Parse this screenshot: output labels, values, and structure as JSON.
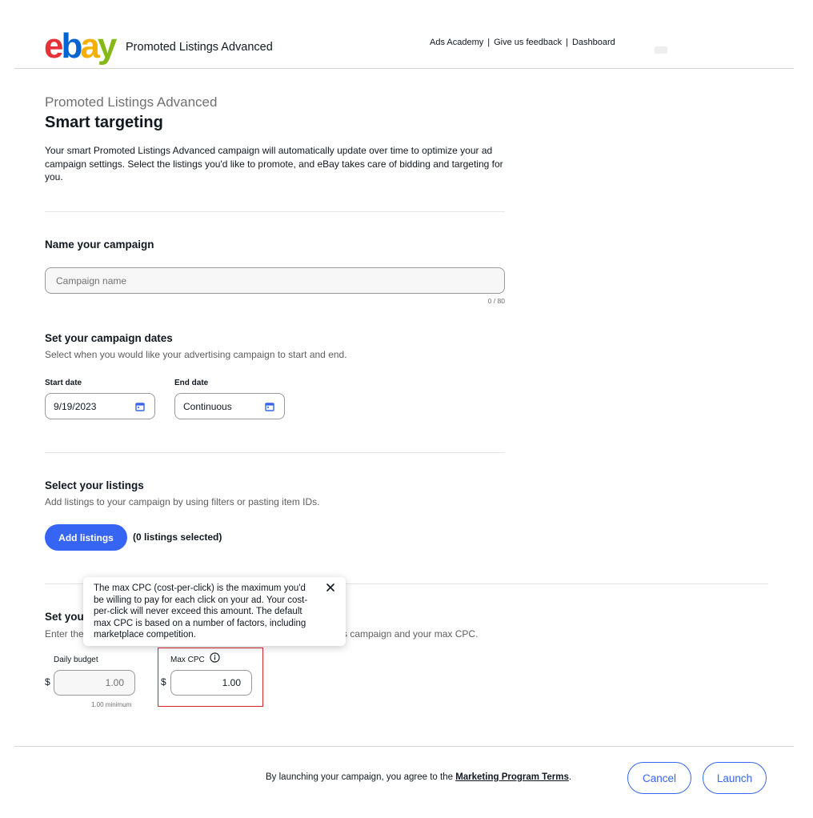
{
  "header": {
    "logo_letters": [
      "e",
      "b",
      "a",
      "y"
    ],
    "product_name": "Promoted Listings Advanced",
    "links": [
      "Ads Academy",
      "Give us feedback",
      "Dashboard"
    ],
    "separator": "|"
  },
  "page": {
    "eyebrow": "Promoted Listings Advanced",
    "title": "Smart targeting",
    "intro": "Your smart Promoted Listings Advanced campaign will automatically update over time to optimize your ad campaign settings. Select the listings you'd like to promote, and eBay takes care of bidding and targeting for you."
  },
  "name_section": {
    "title": "Name your campaign",
    "placeholder": "Campaign name",
    "counter": "0 / 80"
  },
  "dates_section": {
    "title": "Set your campaign dates",
    "subtitle": "Select when you would like your advertising campaign to start and end.",
    "start_label": "Start date",
    "start_value": "9/19/2023",
    "end_label": "End date",
    "end_value": "Continuous"
  },
  "listings_section": {
    "title": "Select your listings",
    "subtitle": "Add listings to your campaign by using filters or pasting item IDs.",
    "add_button": "Add listings",
    "selected_count": "(0 listings selected)"
  },
  "budget_section": {
    "title_visible": "Set you",
    "subtitle_head": "Enter the",
    "subtitle_tail": "s campaign and your max CPC.",
    "currency": "$",
    "daily_label": "Daily budget",
    "daily_value": "1.00",
    "daily_note": "1.00 minimum",
    "cpc_label": "Max CPC",
    "cpc_value": "1.00"
  },
  "tooltip": {
    "text": "The max CPC (cost-per-click) is the maximum you'd be willing to pay for each click on your ad. Your cost-per-click will never exceed this amount. The default max CPC is based on a number of factors, including marketplace competition."
  },
  "footer": {
    "terms_prefix": "By launching your campaign, you agree to the ",
    "terms_link": "Marketing Program Terms",
    "terms_suffix": ".",
    "cancel": "Cancel",
    "launch": "Launch"
  },
  "colors": {
    "primary": "#3665f3",
    "highlight": "#d8272d"
  }
}
